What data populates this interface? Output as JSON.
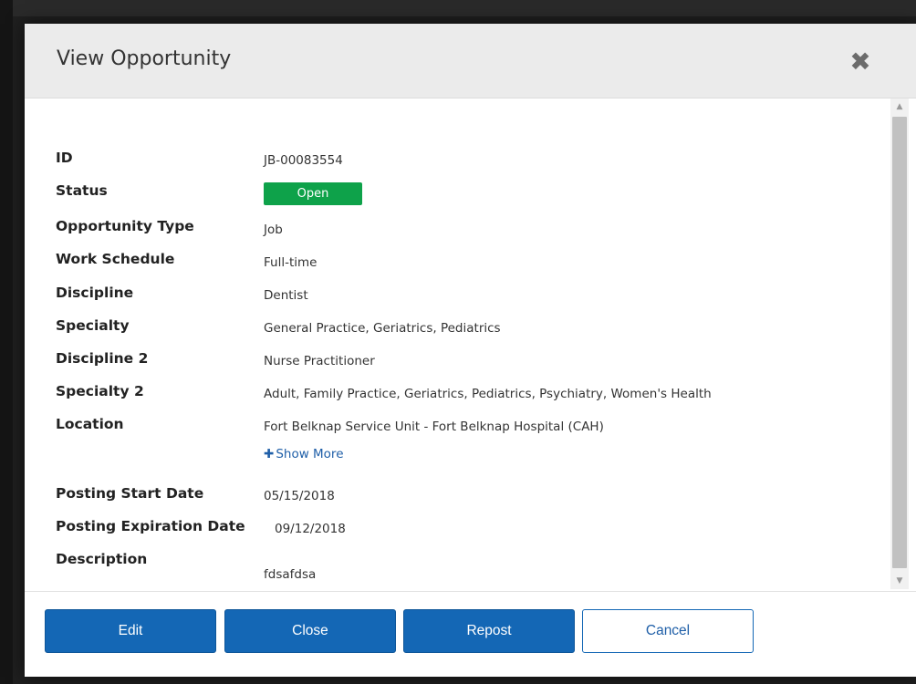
{
  "modal": {
    "title": "View Opportunity",
    "close_icon": "close-icon"
  },
  "fields": {
    "id": {
      "label": "ID",
      "value": "JB-00083554"
    },
    "status": {
      "label": "Status",
      "value": "Open",
      "badge_color": "#0ea24a"
    },
    "opportunity_type": {
      "label": "Opportunity Type",
      "value": "Job"
    },
    "work_schedule": {
      "label": "Work Schedule",
      "value": "Full-time"
    },
    "discipline": {
      "label": "Discipline",
      "value": "Dentist"
    },
    "specialty": {
      "label": "Specialty",
      "value": "General Practice, Geriatrics, Pediatrics"
    },
    "discipline_2": {
      "label": "Discipline 2",
      "value": "Nurse Practitioner"
    },
    "specialty_2": {
      "label": "Specialty 2",
      "value": "Adult, Family Practice, Geriatrics, Pediatrics, Psychiatry, Women's Health"
    },
    "location": {
      "label": "Location",
      "value": "Fort Belknap Service Unit - Fort Belknap Hospital (CAH)",
      "show_more": "Show More"
    },
    "posting_start_date": {
      "label": "Posting Start Date",
      "value": "05/15/2018"
    },
    "posting_expiration_date": {
      "label": "Posting Expiration Date",
      "value": "09/12/2018"
    },
    "description": {
      "label": "Description",
      "value": "fdsafdsa"
    }
  },
  "footer": {
    "edit_label": "Edit",
    "close_label": "Close",
    "repost_label": "Repost",
    "cancel_label": "Cancel"
  },
  "colors": {
    "primary": "#1467b5",
    "header_bg": "#ebebeb",
    "status_open": "#0ea24a",
    "link": "#1f5fa8"
  }
}
